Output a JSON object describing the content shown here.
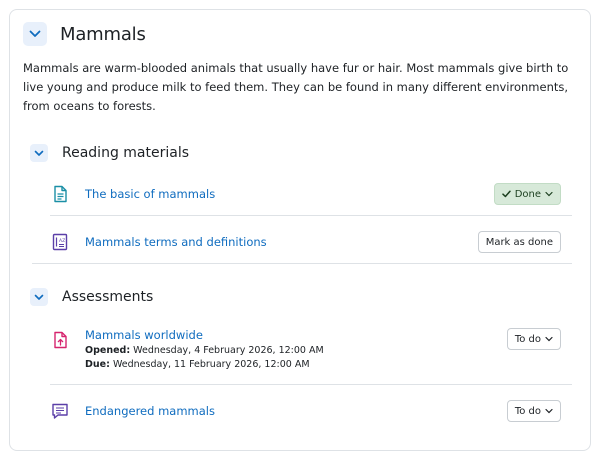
{
  "section": {
    "title": "Mammals",
    "summary": "Mammals are warm-blooded animals that usually have fur or hair. Most mammals give birth to live young and produce milk to feed them. They can be found in many different environments, from oceans to forests."
  },
  "subsections": [
    {
      "title": "Reading materials",
      "activities": [
        {
          "name": "The basic of mammals",
          "icon": "page-icon",
          "status": "Done"
        },
        {
          "name": "Mammals terms and definitions",
          "icon": "glossary-icon",
          "status": "Mark as done"
        }
      ]
    },
    {
      "title": "Assessments",
      "activities": [
        {
          "name": "Mammals worldwide",
          "icon": "assignment-icon",
          "status": "To do",
          "opened_label": "Opened:",
          "opened_value": "Wednesday, 4 February 2026, 12:00 AM",
          "due_label": "Due:",
          "due_value": "Wednesday, 11 February 2026, 12:00 AM"
        },
        {
          "name": "Endangered mammals",
          "icon": "forum-icon",
          "status": "To do"
        }
      ]
    }
  ],
  "colors": {
    "link": "#0f6cbf",
    "done_bg": "#d7e9d9",
    "page_icon": "#1a8fa6",
    "glossary_icon": "#5b3fa8",
    "assignment_icon": "#d6246e",
    "forum_icon": "#5b3fa8"
  }
}
